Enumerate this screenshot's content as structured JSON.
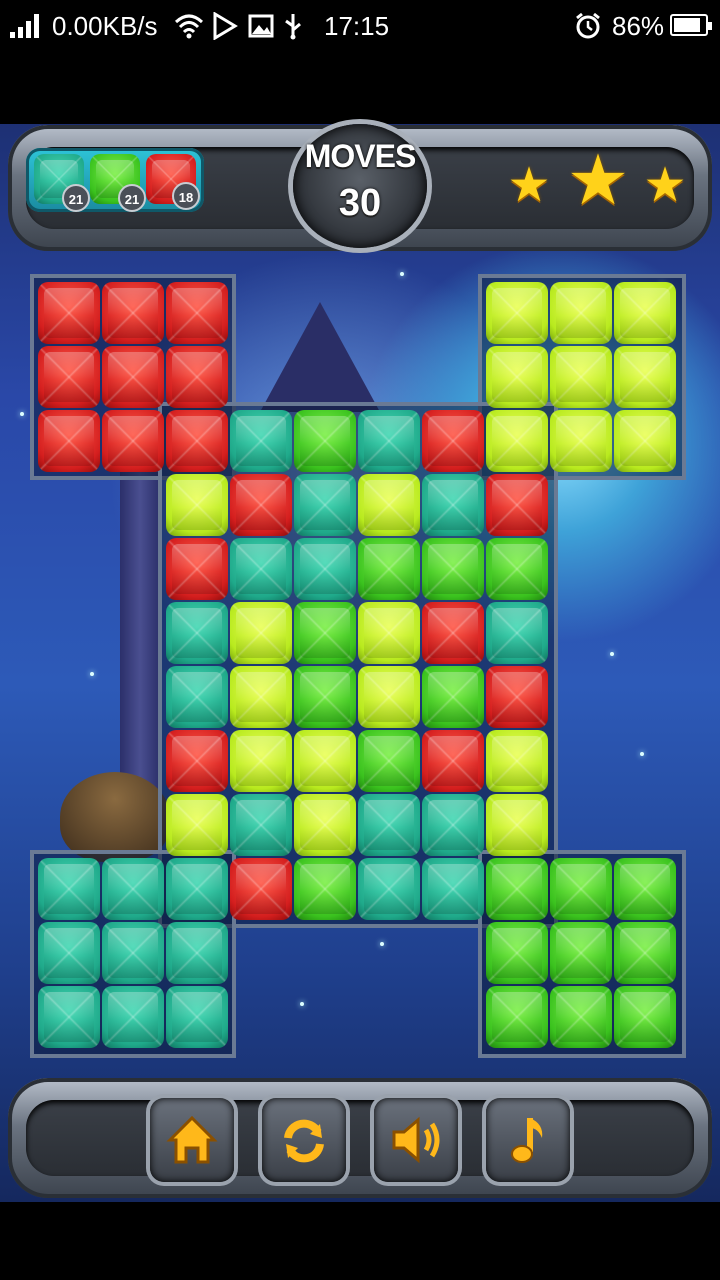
{
  "status_bar": {
    "speed": "0.00KB/s",
    "time": "17:15",
    "battery_percent": "86%",
    "battery_level": 0.86
  },
  "goals": [
    {
      "color": "teal",
      "count": "21"
    },
    {
      "color": "green",
      "count": "21"
    },
    {
      "color": "red",
      "count": "18"
    }
  ],
  "moves": {
    "label": "MOVES",
    "value": "30"
  },
  "stars_earned": 3,
  "board": {
    "rows": [
      [
        "red",
        "red",
        "red",
        null,
        null,
        null,
        null,
        "lime",
        "lime",
        "lime"
      ],
      [
        "red",
        "red",
        "red",
        null,
        null,
        null,
        null,
        "lime",
        "lime",
        "lime"
      ],
      [
        "red",
        "red",
        "red",
        "teal",
        "green",
        "teal",
        "red",
        "lime",
        "lime",
        "lime"
      ],
      [
        null,
        null,
        "lime",
        "red",
        "teal",
        "lime",
        "teal",
        "red",
        null,
        null
      ],
      [
        null,
        null,
        "red",
        "teal",
        "teal",
        "green",
        "green",
        "green",
        null,
        null
      ],
      [
        null,
        null,
        "teal",
        "lime",
        "green",
        "lime",
        "red",
        "teal",
        null,
        null
      ],
      [
        null,
        null,
        "teal",
        "lime",
        "green",
        "lime",
        "green",
        "red",
        null,
        null
      ],
      [
        null,
        null,
        "red",
        "lime",
        "lime",
        "green",
        "red",
        "lime",
        null,
        null
      ],
      [
        null,
        null,
        "lime",
        "teal",
        "lime",
        "teal",
        "teal",
        "lime",
        null,
        null
      ],
      [
        "teal",
        "teal",
        "teal",
        "red",
        "green",
        "teal",
        "teal",
        "green",
        "green",
        "green"
      ],
      [
        "teal",
        "teal",
        "teal",
        null,
        null,
        null,
        null,
        "green",
        "green",
        "green"
      ],
      [
        "teal",
        "teal",
        "teal",
        null,
        null,
        null,
        null,
        "green",
        "green",
        "green"
      ]
    ]
  },
  "controls": [
    {
      "name": "home-button",
      "icon": "home-icon"
    },
    {
      "name": "restart-button",
      "icon": "restart-icon"
    },
    {
      "name": "sound-button",
      "icon": "speaker-icon"
    },
    {
      "name": "music-button",
      "icon": "music-note-icon"
    }
  ],
  "colors": {
    "red": "#d41e1e",
    "teal": "#1fa98a",
    "green": "#3ac21e",
    "lime": "#b8ea1e",
    "star": "#ffd21a",
    "icon": "#ffb81a"
  }
}
